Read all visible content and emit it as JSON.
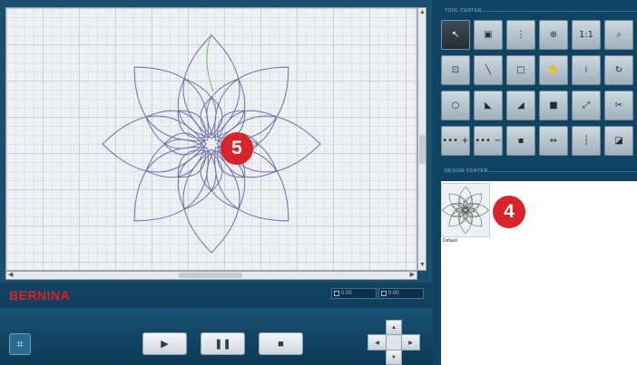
{
  "brand": "BERNINA",
  "badges": {
    "canvas_callout": "5",
    "design_callout": "4"
  },
  "status": {
    "x_value": "0.00",
    "y_value": "0.00"
  },
  "right_panel": {
    "tool_center_title": "TOOL CENTER",
    "design_center_title": "DESIGN CENTER",
    "design_thumb_label": "Default"
  },
  "tools": [
    {
      "name": "select-tool",
      "glyph": "↖",
      "active": true
    },
    {
      "name": "node-tool",
      "glyph": "▣",
      "active": false
    },
    {
      "name": "move-layer-tool",
      "glyph": "⋮",
      "active": false
    },
    {
      "name": "zoom-in-tool",
      "glyph": "⊕",
      "active": false
    },
    {
      "name": "zoom-100-tool",
      "glyph": "1:1",
      "active": false
    },
    {
      "name": "zoom-tool",
      "glyph": "⌕",
      "active": false
    },
    {
      "name": "machine-tool",
      "glyph": "⊡",
      "active": false
    },
    {
      "name": "needle-tool",
      "glyph": "╲",
      "active": false
    },
    {
      "name": "frame-tool",
      "glyph": "□",
      "active": false
    },
    {
      "name": "pan-tool",
      "glyph": "✋",
      "active": false
    },
    {
      "name": "stitch-points-tool",
      "glyph": "⁞",
      "active": false
    },
    {
      "name": "rotate-tool",
      "glyph": "↻",
      "active": false
    },
    {
      "name": "circle-tool",
      "glyph": "○",
      "active": false
    },
    {
      "name": "mirror-tool",
      "glyph": "◣",
      "active": false
    },
    {
      "name": "triangle-tool",
      "glyph": "◢",
      "active": false
    },
    {
      "name": "square-tool",
      "glyph": "■",
      "active": false
    },
    {
      "name": "scale-tool",
      "glyph": "⤢",
      "active": false
    },
    {
      "name": "cut-tool",
      "glyph": "✂",
      "active": false
    },
    {
      "name": "stitch-plus-tool",
      "glyph": "••• +",
      "active": false
    },
    {
      "name": "stitch-minus-tool",
      "glyph": "••• −",
      "active": false
    },
    {
      "name": "layer-tool",
      "glyph": "▪",
      "active": false
    },
    {
      "name": "link-tool",
      "glyph": "⇔",
      "active": false
    },
    {
      "name": "ruler-tool",
      "glyph": "┆",
      "active": false
    },
    {
      "name": "resize-tool",
      "glyph": "◪",
      "active": false
    }
  ],
  "media_controls": {
    "play": "▶",
    "pause": "❚❚",
    "stop": "■"
  },
  "colors": {
    "accent": "#d8232a",
    "stitch": "#6c6fae",
    "panel": "#0f4361"
  }
}
